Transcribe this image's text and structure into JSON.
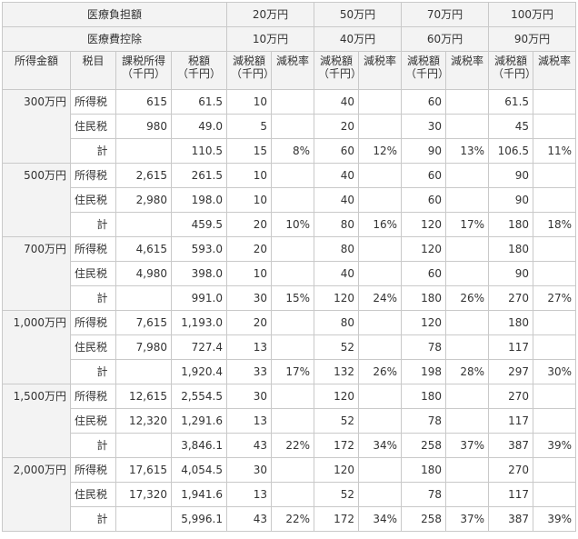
{
  "header": {
    "burden_label": "医療負担額",
    "deduction_label": "医療費控除",
    "burden_values": [
      "20万円",
      "50万円",
      "70万円",
      "100万円"
    ],
    "deduction_values": [
      "10万円",
      "40万円",
      "60万円",
      "90万円"
    ],
    "columns": {
      "income": "所得金額",
      "tax_item": "税目",
      "taxable_income": "課税所得",
      "taxable_income_unit": "（千円）",
      "tax_amount": "税額",
      "tax_amount_unit": "（千円）",
      "reduction_amount": "減税額",
      "reduction_amount_unit": "（千円）",
      "reduction_rate": "減税率"
    }
  },
  "groups": [
    {
      "income": "300万円",
      "rows": [
        {
          "item": "所得税",
          "taxable": "615",
          "tax": "61.5",
          "cells": [
            [
              "10",
              ""
            ],
            [
              "40",
              ""
            ],
            [
              "60",
              ""
            ],
            [
              "61.5",
              ""
            ]
          ]
        },
        {
          "item": "住民税",
          "taxable": "980",
          "tax": "49.0",
          "cells": [
            [
              "5",
              ""
            ],
            [
              "20",
              ""
            ],
            [
              "30",
              ""
            ],
            [
              "45",
              ""
            ]
          ]
        },
        {
          "item": "計",
          "taxable": "",
          "tax": "110.5",
          "cells": [
            [
              "15",
              "8%"
            ],
            [
              "60",
              "12%"
            ],
            [
              "90",
              "13%"
            ],
            [
              "106.5",
              "11%"
            ]
          ]
        }
      ]
    },
    {
      "income": "500万円",
      "rows": [
        {
          "item": "所得税",
          "taxable": "2,615",
          "tax": "261.5",
          "cells": [
            [
              "10",
              ""
            ],
            [
              "40",
              ""
            ],
            [
              "60",
              ""
            ],
            [
              "90",
              ""
            ]
          ]
        },
        {
          "item": "住民税",
          "taxable": "2,980",
          "tax": "198.0",
          "cells": [
            [
              "10",
              ""
            ],
            [
              "40",
              ""
            ],
            [
              "60",
              ""
            ],
            [
              "90",
              ""
            ]
          ]
        },
        {
          "item": "計",
          "taxable": "",
          "tax": "459.5",
          "cells": [
            [
              "20",
              "10%"
            ],
            [
              "80",
              "16%"
            ],
            [
              "120",
              "17%"
            ],
            [
              "180",
              "18%"
            ]
          ]
        }
      ]
    },
    {
      "income": "700万円",
      "rows": [
        {
          "item": "所得税",
          "taxable": "4,615",
          "tax": "593.0",
          "cells": [
            [
              "20",
              ""
            ],
            [
              "80",
              ""
            ],
            [
              "120",
              ""
            ],
            [
              "180",
              ""
            ]
          ]
        },
        {
          "item": "住民税",
          "taxable": "4,980",
          "tax": "398.0",
          "cells": [
            [
              "10",
              ""
            ],
            [
              "40",
              ""
            ],
            [
              "60",
              ""
            ],
            [
              "90",
              ""
            ]
          ]
        },
        {
          "item": "計",
          "taxable": "",
          "tax": "991.0",
          "cells": [
            [
              "30",
              "15%"
            ],
            [
              "120",
              "24%"
            ],
            [
              "180",
              "26%"
            ],
            [
              "270",
              "27%"
            ]
          ]
        }
      ]
    },
    {
      "income": "1,000万円",
      "rows": [
        {
          "item": "所得税",
          "taxable": "7,615",
          "tax": "1,193.0",
          "cells": [
            [
              "20",
              ""
            ],
            [
              "80",
              ""
            ],
            [
              "120",
              ""
            ],
            [
              "180",
              ""
            ]
          ]
        },
        {
          "item": "住民税",
          "taxable": "7,980",
          "tax": "727.4",
          "cells": [
            [
              "13",
              ""
            ],
            [
              "52",
              ""
            ],
            [
              "78",
              ""
            ],
            [
              "117",
              ""
            ]
          ]
        },
        {
          "item": "計",
          "taxable": "",
          "tax": "1,920.4",
          "cells": [
            [
              "33",
              "17%"
            ],
            [
              "132",
              "26%"
            ],
            [
              "198",
              "28%"
            ],
            [
              "297",
              "30%"
            ]
          ]
        }
      ]
    },
    {
      "income": "1,500万円",
      "rows": [
        {
          "item": "所得税",
          "taxable": "12,615",
          "tax": "2,554.5",
          "cells": [
            [
              "30",
              ""
            ],
            [
              "120",
              ""
            ],
            [
              "180",
              ""
            ],
            [
              "270",
              ""
            ]
          ]
        },
        {
          "item": "住民税",
          "taxable": "12,320",
          "tax": "1,291.6",
          "cells": [
            [
              "13",
              ""
            ],
            [
              "52",
              ""
            ],
            [
              "78",
              ""
            ],
            [
              "117",
              ""
            ]
          ]
        },
        {
          "item": "計",
          "taxable": "",
          "tax": "3,846.1",
          "cells": [
            [
              "43",
              "22%"
            ],
            [
              "172",
              "34%"
            ],
            [
              "258",
              "37%"
            ],
            [
              "387",
              "39%"
            ]
          ]
        }
      ]
    },
    {
      "income": "2,000万円",
      "rows": [
        {
          "item": "所得税",
          "taxable": "17,615",
          "tax": "4,054.5",
          "cells": [
            [
              "30",
              ""
            ],
            [
              "120",
              ""
            ],
            [
              "180",
              ""
            ],
            [
              "270",
              ""
            ]
          ]
        },
        {
          "item": "住民税",
          "taxable": "17,320",
          "tax": "1,941.6",
          "cells": [
            [
              "13",
              ""
            ],
            [
              "52",
              ""
            ],
            [
              "78",
              ""
            ],
            [
              "117",
              ""
            ]
          ]
        },
        {
          "item": "計",
          "taxable": "",
          "tax": "5,996.1",
          "cells": [
            [
              "43",
              "22%"
            ],
            [
              "172",
              "34%"
            ],
            [
              "258",
              "37%"
            ],
            [
              "387",
              "39%"
            ]
          ]
        }
      ]
    }
  ]
}
